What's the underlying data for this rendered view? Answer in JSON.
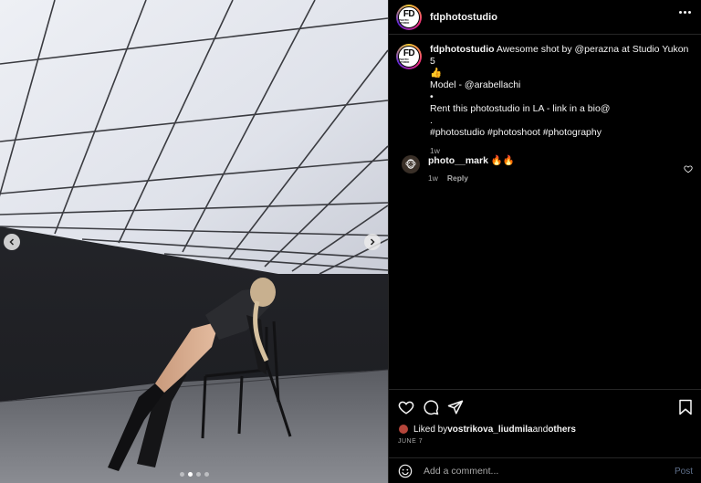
{
  "post": {
    "username": "fdphotostudio",
    "avatar_text": "FD",
    "avatar_subtext": "PHOTO STUDIO",
    "caption": {
      "username": "fdphotostudio",
      "line1": " Awesome shot by @perazna at Studio Yukon 5",
      "line2": "👍",
      "line3": "Model - @arabellachi",
      "line4": "•",
      "line5": "Rent this photostudio in LA - link in a bio@",
      "line6": ".",
      "line7": "#photostudio #photoshoot #photography",
      "time": "1w"
    },
    "comment": {
      "username": "photo__mark",
      "text": " 🔥🔥",
      "time": "1w",
      "reply_label": "Reply",
      "avatar_glyph": "🐵"
    },
    "likes": {
      "prefix": "Liked by ",
      "user": "vostrikova_liudmila",
      "middle": " and ",
      "others": "others"
    },
    "date": "JUNE 7",
    "add_comment": {
      "placeholder": "Add a comment...",
      "post_label": "Post"
    },
    "carousel": {
      "total": 4,
      "active": 1
    }
  },
  "icons": {
    "heart": "heart-icon",
    "comment": "comment-icon",
    "share": "share-icon",
    "save": "bookmark-icon",
    "emoji": "emoji-icon",
    "more": "more-icon",
    "prev": "chevron-left-icon",
    "next": "chevron-right-icon"
  },
  "colors": {
    "background": "#000000",
    "text": "#f5f5f5",
    "muted": "#a8a8a8",
    "post_button": "#5e6f8a"
  }
}
